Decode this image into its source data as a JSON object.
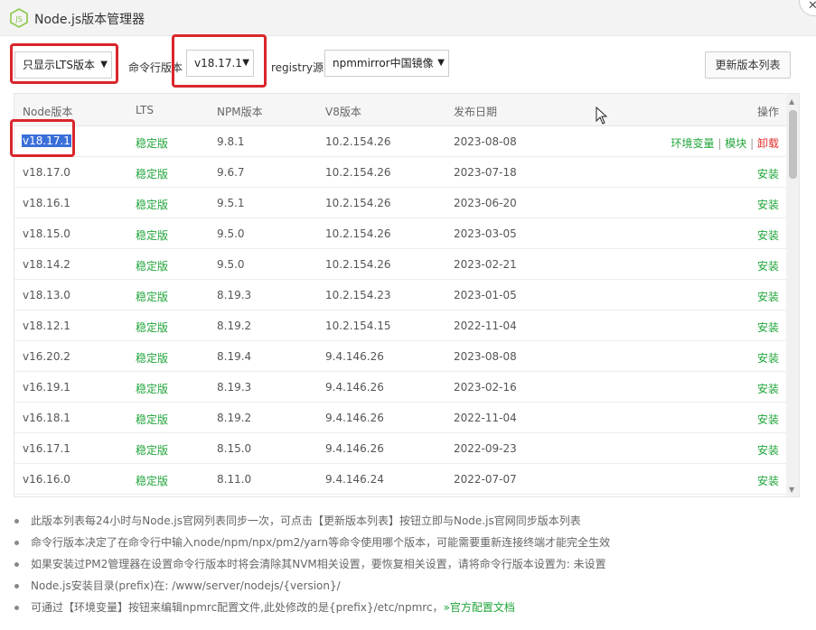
{
  "window": {
    "title": "Node.js版本管理器",
    "icon": "nodejs-logo-icon",
    "accent_color": "#20a53a",
    "danger_color": "#e0302e",
    "highlight_color": "#d9262c"
  },
  "toolbar": {
    "filter_select": "只显示LTS版本",
    "cli_version_label": "命令行版本",
    "cli_version_select": "v18.17.1",
    "registry_label": "registry源",
    "registry_select": "npmmirror中国镜像",
    "refresh_button": "更新版本列表"
  },
  "table": {
    "headers": {
      "node_version": "Node版本",
      "lts": "LTS",
      "npm_version": "NPM版本",
      "v8_version": "V8版本",
      "release_date": "发布日期",
      "actions": "操作"
    },
    "rows": [
      {
        "node": "v18.17.1",
        "lts": "稳定版",
        "npm": "9.8.1",
        "v8": "10.2.154.26",
        "date": "2023-08-08"
      },
      {
        "node": "v18.17.0",
        "lts": "稳定版",
        "npm": "9.6.7",
        "v8": "10.2.154.26",
        "date": "2023-07-18",
        "install": "安装"
      },
      {
        "node": "v18.16.1",
        "lts": "稳定版",
        "npm": "9.5.1",
        "v8": "10.2.154.26",
        "date": "2023-06-20",
        "install": "安装"
      },
      {
        "node": "v18.15.0",
        "lts": "稳定版",
        "npm": "9.5.0",
        "v8": "10.2.154.26",
        "date": "2023-03-05",
        "install": "安装"
      },
      {
        "node": "v18.14.2",
        "lts": "稳定版",
        "npm": "9.5.0",
        "v8": "10.2.154.26",
        "date": "2023-02-21",
        "install": "安装"
      },
      {
        "node": "v18.13.0",
        "lts": "稳定版",
        "npm": "8.19.3",
        "v8": "10.2.154.23",
        "date": "2023-01-05",
        "install": "安装"
      },
      {
        "node": "v18.12.1",
        "lts": "稳定版",
        "npm": "8.19.2",
        "v8": "10.2.154.15",
        "date": "2022-11-04",
        "install": "安装"
      },
      {
        "node": "v16.20.2",
        "lts": "稳定版",
        "npm": "8.19.4",
        "v8": "9.4.146.26",
        "date": "2023-08-08",
        "install": "安装"
      },
      {
        "node": "v16.19.1",
        "lts": "稳定版",
        "npm": "8.19.3",
        "v8": "9.4.146.26",
        "date": "2023-02-16",
        "install": "安装"
      },
      {
        "node": "v16.18.1",
        "lts": "稳定版",
        "npm": "8.19.2",
        "v8": "9.4.146.26",
        "date": "2022-11-04",
        "install": "安装"
      },
      {
        "node": "v16.17.1",
        "lts": "稳定版",
        "npm": "8.15.0",
        "v8": "9.4.146.26",
        "date": "2022-09-23",
        "install": "安装"
      },
      {
        "node": "v16.16.0",
        "lts": "稳定版",
        "npm": "8.11.0",
        "v8": "9.4.146.24",
        "date": "2022-07-07",
        "install": "安装"
      }
    ],
    "installed_actions": {
      "env": "环境变量",
      "sep": "|",
      "module": "模块",
      "uninstall": "卸载"
    }
  },
  "notes": [
    {
      "text": "此版本列表每24小时与Node.js官网列表同步一次，可点击【更新版本列表】按钮立即与Node.js官网同步版本列表"
    },
    {
      "text": "命令行版本决定了在命令行中输入node/npm/npx/pm2/yarn等命令使用哪个版本，可能需要重新连接终端才能完全生效"
    },
    {
      "text": "如果安装过PM2管理器在设置命令行版本时将会清除其NVM相关设置，要恢复相关设置，请将命令行版本设置为: 未设置"
    },
    {
      "text": "Node.js安装目录(prefix)在: /www/server/nodejs/{version}/"
    },
    {
      "text": "可通过【环境变量】按钮来编辑npmrc配置文件,此处修改的是{prefix}/etc/npmrc，",
      "link": "»官方配置文档"
    }
  ]
}
